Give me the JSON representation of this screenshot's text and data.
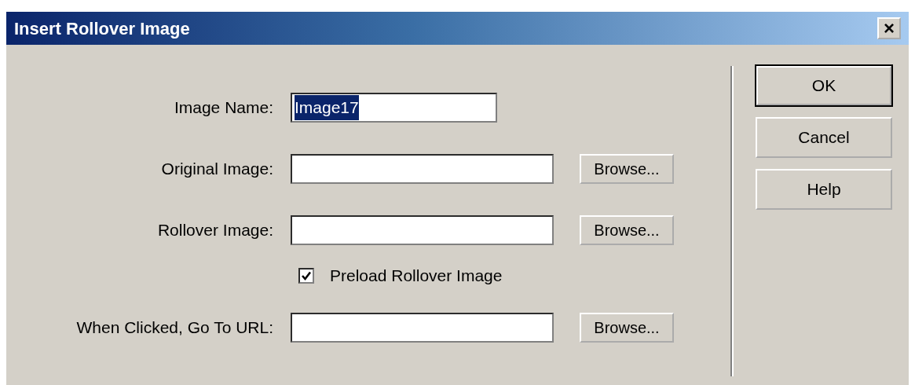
{
  "window": {
    "title": "Insert Rollover Image",
    "close": "×"
  },
  "fields": [
    {
      "label": "Image Name:",
      "value": "Image17",
      "text_selected": true
    },
    {
      "label": "Original Image:",
      "browse": "Browse..."
    },
    {
      "label": "Rollover Image:",
      "browse": "Browse..."
    },
    {
      "label": "When Clicked, Go To URL:",
      "browse": "Browse..."
    }
  ],
  "preload": {
    "label": "Preload Rollover Image",
    "checked": true
  },
  "buttons": [
    {
      "label": "OK",
      "default": true
    },
    {
      "label": "Cancel",
      "default": false
    },
    {
      "label": "Help",
      "default": false
    }
  ]
}
